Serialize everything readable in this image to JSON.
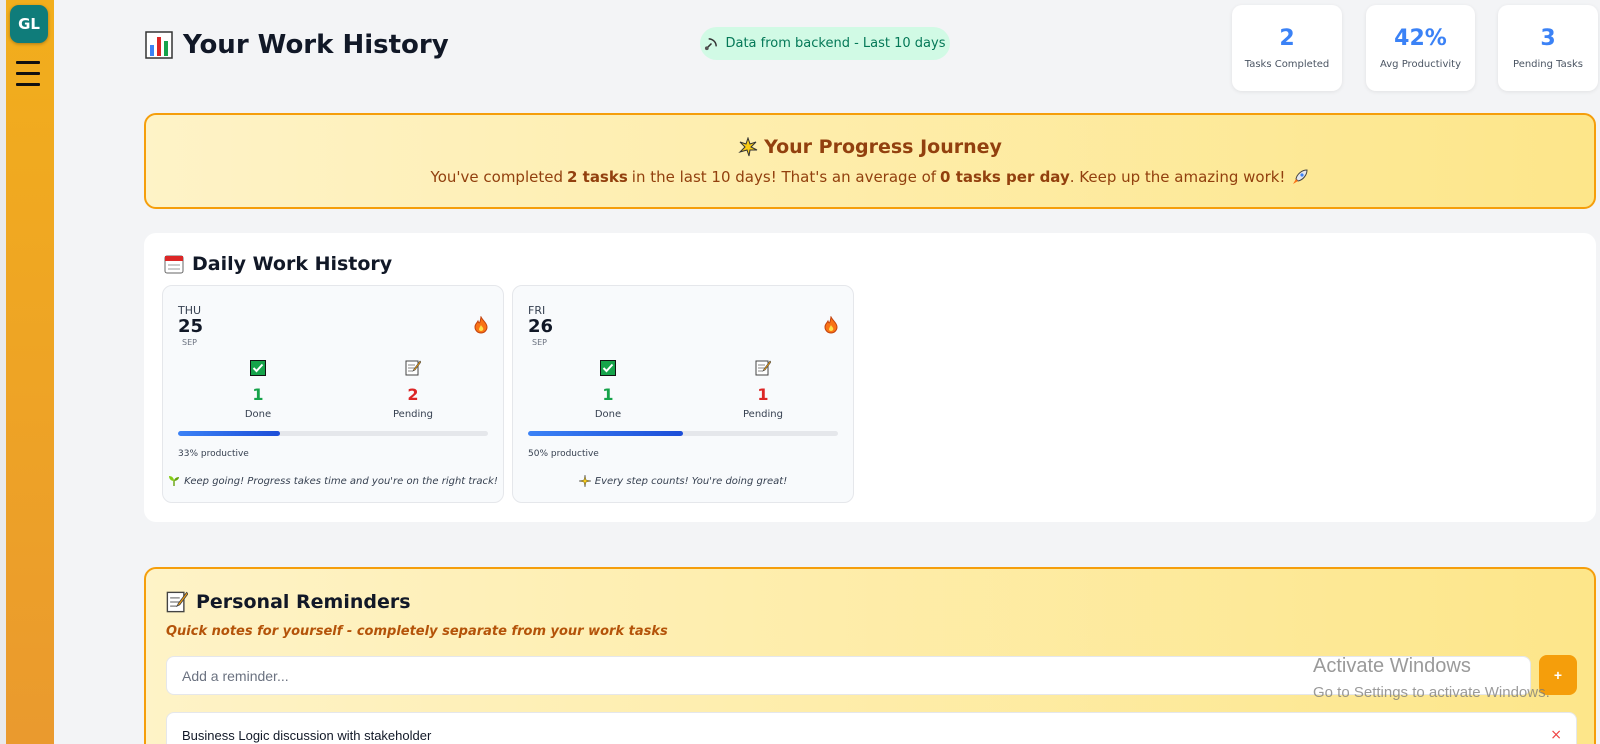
{
  "sidebar": {
    "avatar_initials": "GL"
  },
  "header": {
    "title": "Your Work History",
    "backend_status": "Data from backend - Last 10 days"
  },
  "stats": [
    {
      "value": "2",
      "label": "Tasks Completed"
    },
    {
      "value": "42%",
      "label": "Avg Productivity"
    },
    {
      "value": "3",
      "label": "Pending Tasks"
    }
  ],
  "progress": {
    "title": "Your Progress Journey",
    "text_prefix": "You've completed",
    "tasks": "2 tasks",
    "text_middle": "in the last 10 days! That's an average of",
    "avg": "0 tasks per day",
    "text_suffix": ". Keep up the amazing work!"
  },
  "daily": {
    "title": "Daily Work History",
    "days": [
      {
        "weekday": "THU",
        "day": "25",
        "month": "SEP",
        "done": "1",
        "done_label": "Done",
        "pending": "2",
        "pending_label": "Pending",
        "productivity": 0.33,
        "productive_text": "33% productive",
        "message": "Keep going! Progress takes time and you're on the right track!"
      },
      {
        "weekday": "FRI",
        "day": "26",
        "month": "SEP",
        "done": "1",
        "done_label": "Done",
        "pending": "1",
        "pending_label": "Pending",
        "productivity": 0.5,
        "productive_text": "50% productive",
        "message": "Every step counts! You're doing great!"
      }
    ]
  },
  "reminders": {
    "title": "Personal Reminders",
    "subtitle": "Quick notes for yourself - completely separate from your work tasks",
    "input_placeholder": "Add a reminder...",
    "add_label": "+",
    "items": [
      {
        "text": "Business Logic discussion with stakeholder",
        "delete": "×"
      }
    ]
  },
  "watermark": {
    "title": "Activate Windows",
    "subtitle": "Go to Settings to activate Windows."
  },
  "colors": {
    "accent": "#f59e0b",
    "stat_blue": "#3b82f6",
    "done_green": "#16a34a",
    "pending_red": "#dc2626"
  }
}
